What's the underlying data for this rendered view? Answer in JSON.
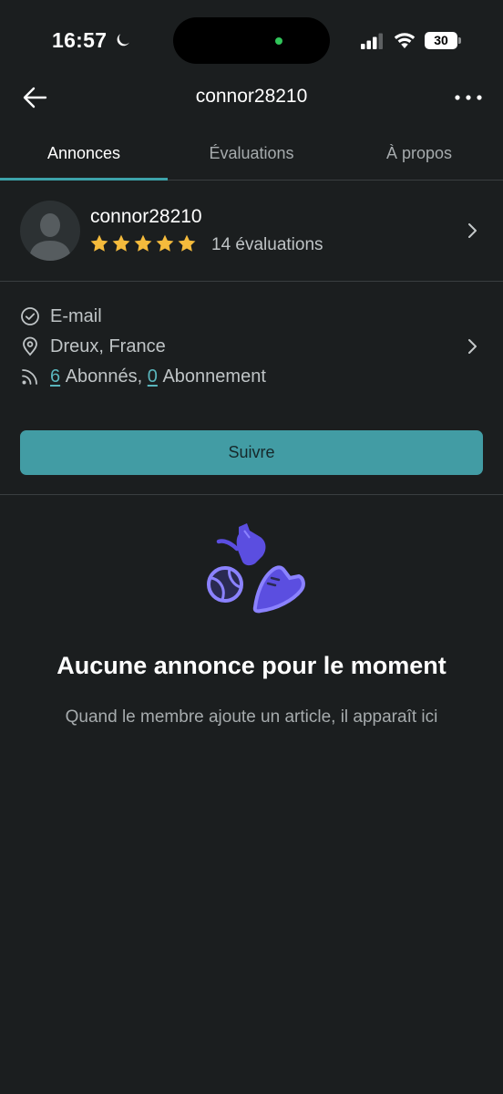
{
  "status": {
    "time": "16:57",
    "battery": "30"
  },
  "nav": {
    "title": "connor28210"
  },
  "tabs": [
    {
      "label": "Annonces",
      "active": true
    },
    {
      "label": "Évaluations",
      "active": false
    },
    {
      "label": "À propos",
      "active": false
    }
  ],
  "profile": {
    "username": "connor28210",
    "rating_stars": 5,
    "rating_text": "14 évaluations"
  },
  "info": {
    "email": "E-mail",
    "location": "Dreux, France",
    "followers_count": "6",
    "followers_label": "Abonnés,",
    "following_count": "0",
    "following_label": "Abonnement"
  },
  "follow_button": "Suivre",
  "empty": {
    "title": "Aucune annonce pour le moment",
    "subtitle": "Quand le membre ajoute un article, il apparaît ici"
  },
  "colors": {
    "background": "#1b1e1f",
    "accent": "#429ca4",
    "star": "#f5bb3c",
    "illustration": "#5b4ee0"
  },
  "icons": [
    "moon-icon",
    "signal-icon",
    "wifi-icon",
    "back-arrow-icon",
    "more-icon",
    "chevron-right-icon",
    "check-circle-icon",
    "location-pin-icon",
    "rss-icon",
    "star-icon"
  ]
}
